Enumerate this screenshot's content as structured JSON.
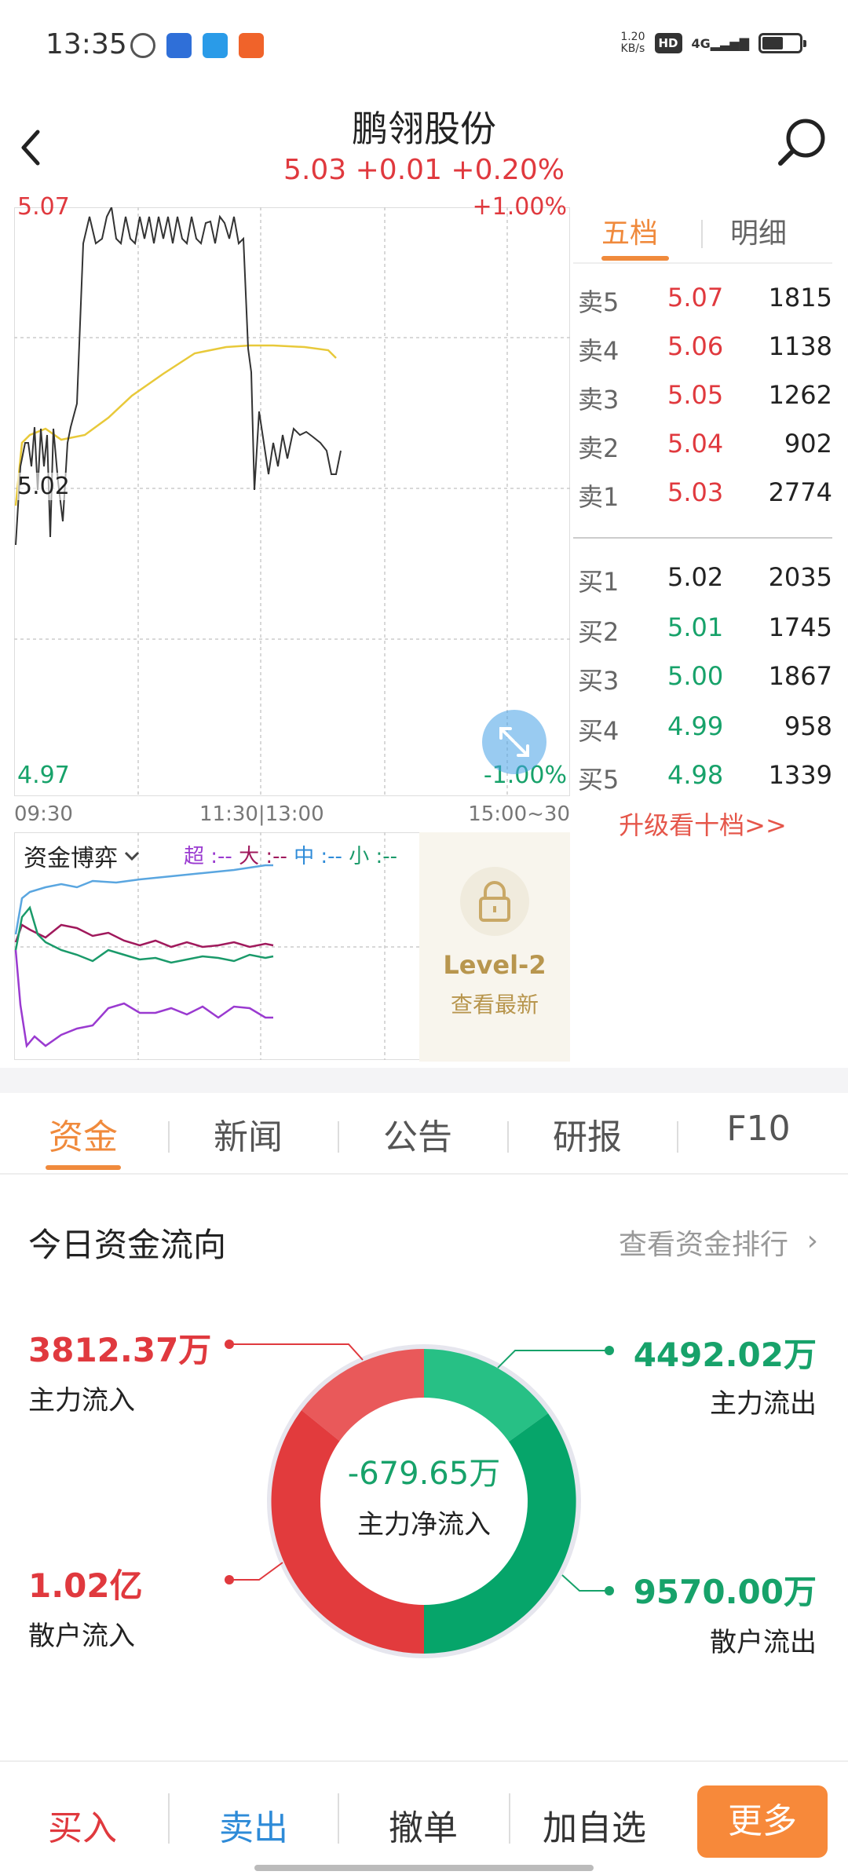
{
  "status": {
    "time": "13:35",
    "net_speed_value": "1.20",
    "net_speed_unit": "KB/s",
    "hd": "HD",
    "signal": "4G",
    "battery_level": 0.55
  },
  "header": {
    "title": "鹏翎股份",
    "quote": "5.03 +0.01 +0.20%"
  },
  "timeline": {
    "price_high": "5.07",
    "pct_high": "+1.00%",
    "price_low": "4.97",
    "pct_low": "-1.00%",
    "last_price_tag": "5.02",
    "time_start": "09:30",
    "time_mid": "11:30|13:00",
    "time_end": "15:00~30"
  },
  "fund_game": {
    "title": "资金博弈",
    "legend_super": "超 :--",
    "legend_big": "大 :--",
    "legend_mid": "中 :--",
    "legend_small": "小 :--"
  },
  "level2": {
    "title": "Level-2",
    "subtitle": "查看最新"
  },
  "order_book": {
    "tab_active": "五档",
    "tab_other": "明细",
    "asks": [
      {
        "label": "卖5",
        "price": "5.07",
        "volume": "1815"
      },
      {
        "label": "卖4",
        "price": "5.06",
        "volume": "1138"
      },
      {
        "label": "卖3",
        "price": "5.05",
        "volume": "1262"
      },
      {
        "label": "卖2",
        "price": "5.04",
        "volume": "902"
      },
      {
        "label": "卖1",
        "price": "5.03",
        "volume": "2774"
      }
    ],
    "bids": [
      {
        "label": "买1",
        "price": "5.02",
        "volume": "2035"
      },
      {
        "label": "买2",
        "price": "5.01",
        "volume": "1745"
      },
      {
        "label": "买3",
        "price": "5.00",
        "volume": "1867"
      },
      {
        "label": "买4",
        "price": "4.99",
        "volume": "958"
      },
      {
        "label": "买5",
        "price": "4.98",
        "volume": "1339"
      }
    ],
    "upgrade": "升级看十档>>"
  },
  "tabs": [
    "资金",
    "新闻",
    "公告",
    "研报",
    "F10"
  ],
  "capital_flow": {
    "title": "今日资金流向",
    "rank_link": "查看资金排行",
    "main_in_value": "3812.37万",
    "main_in_label": "主力流入",
    "main_out_value": "4492.02万",
    "main_out_label": "主力流出",
    "retail_in_value": "1.02亿",
    "retail_in_label": "散户流入",
    "retail_out_value": "9570.00万",
    "retail_out_label": "散户流出",
    "net_value": "-679.65万",
    "net_label": "主力净流入"
  },
  "colors": {
    "up": "#e0393e",
    "down": "#17a26a",
    "accent": "#f08a3c",
    "blue": "#2e8bd8"
  },
  "bottom_bar": {
    "buy": "买入",
    "sell": "卖出",
    "cancel": "撤单",
    "watch": "加自选",
    "more": "更多"
  }
}
